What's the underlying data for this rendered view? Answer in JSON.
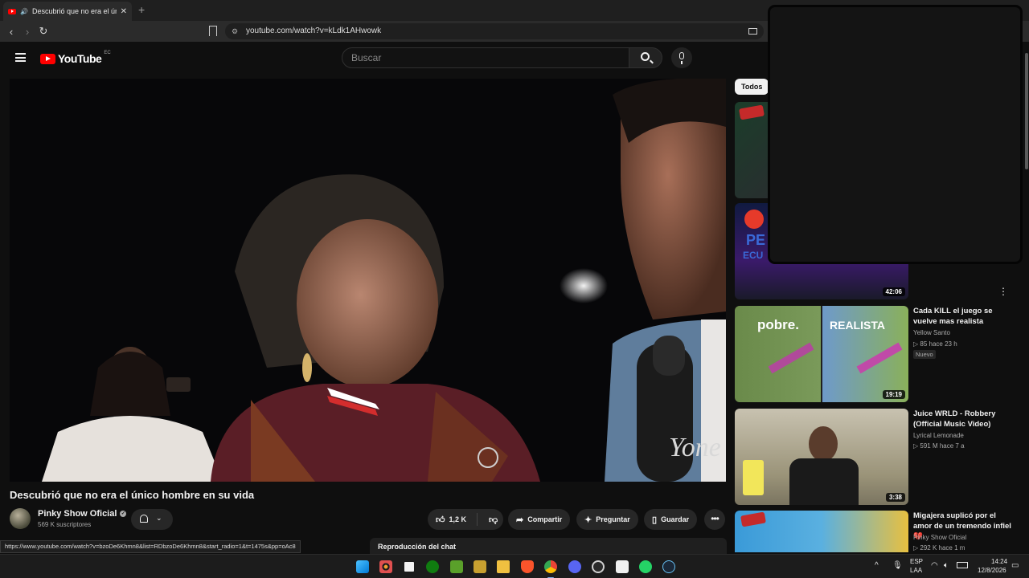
{
  "browser": {
    "tab_title": "Descubrió que no era el único",
    "tab_speaker": "🔊",
    "tab_close": "✕",
    "new_tab": "+",
    "url": "youtube.com/watch?v=kLdk1AHwowk",
    "status_url": "https://www.youtube.com/watch?v=bzoDe6Khmn8&list=RDbzoDe6Khmn8&start_radio=1&t=1475s&pp=oAc8"
  },
  "youtube": {
    "logo_text": "YouTube",
    "region": "EC",
    "search_placeholder": "Buscar"
  },
  "video": {
    "title": "Descubrió que no era el único hombre en su vida",
    "channel": "Pinky Show Oficial",
    "subscribers": "569 K suscriptores",
    "likes": "1,2 K",
    "share_label": "Compartir",
    "ask_label": "Preguntar",
    "save_label": "Guardar",
    "more_label": "•••",
    "chat_label": "Reproducción del chat"
  },
  "sidebar": {
    "chip_all": "Todos",
    "items": [
      {
        "duration": "",
        "title": "",
        "channel": "",
        "meta": ""
      },
      {
        "duration": "42:06",
        "title": "",
        "channel": "",
        "meta": ""
      },
      {
        "duration": "19:19",
        "title": "Cada KILL el juego se vuelve mas realista",
        "channel": "Yellow Santo",
        "meta": "▷ 85  hace 23 h",
        "badge": "Nuevo",
        "thumb_left": "pobre.",
        "thumb_right": "REALISTA"
      },
      {
        "duration": "3:38",
        "title": "Juice WRLD - Robbery (Official Music Video)",
        "channel": "Lyrical Lemonade",
        "meta": "▷ 591 M  hace 7 a"
      },
      {
        "duration": "",
        "title": "Migajera suplicó por el amor de un tremendo infiel 💔",
        "channel": "Pinky Show Oficial",
        "meta": "▷ 292 K  hace 1 m"
      }
    ]
  },
  "taskbar": {
    "lang_top": "ESP",
    "lang_bottom": "LAA",
    "time": "14:24",
    "date": "12/8/2026"
  },
  "colors": {
    "youtube_red": "#ff0000",
    "background": "#0f0f0f",
    "pill": "#272727"
  }
}
